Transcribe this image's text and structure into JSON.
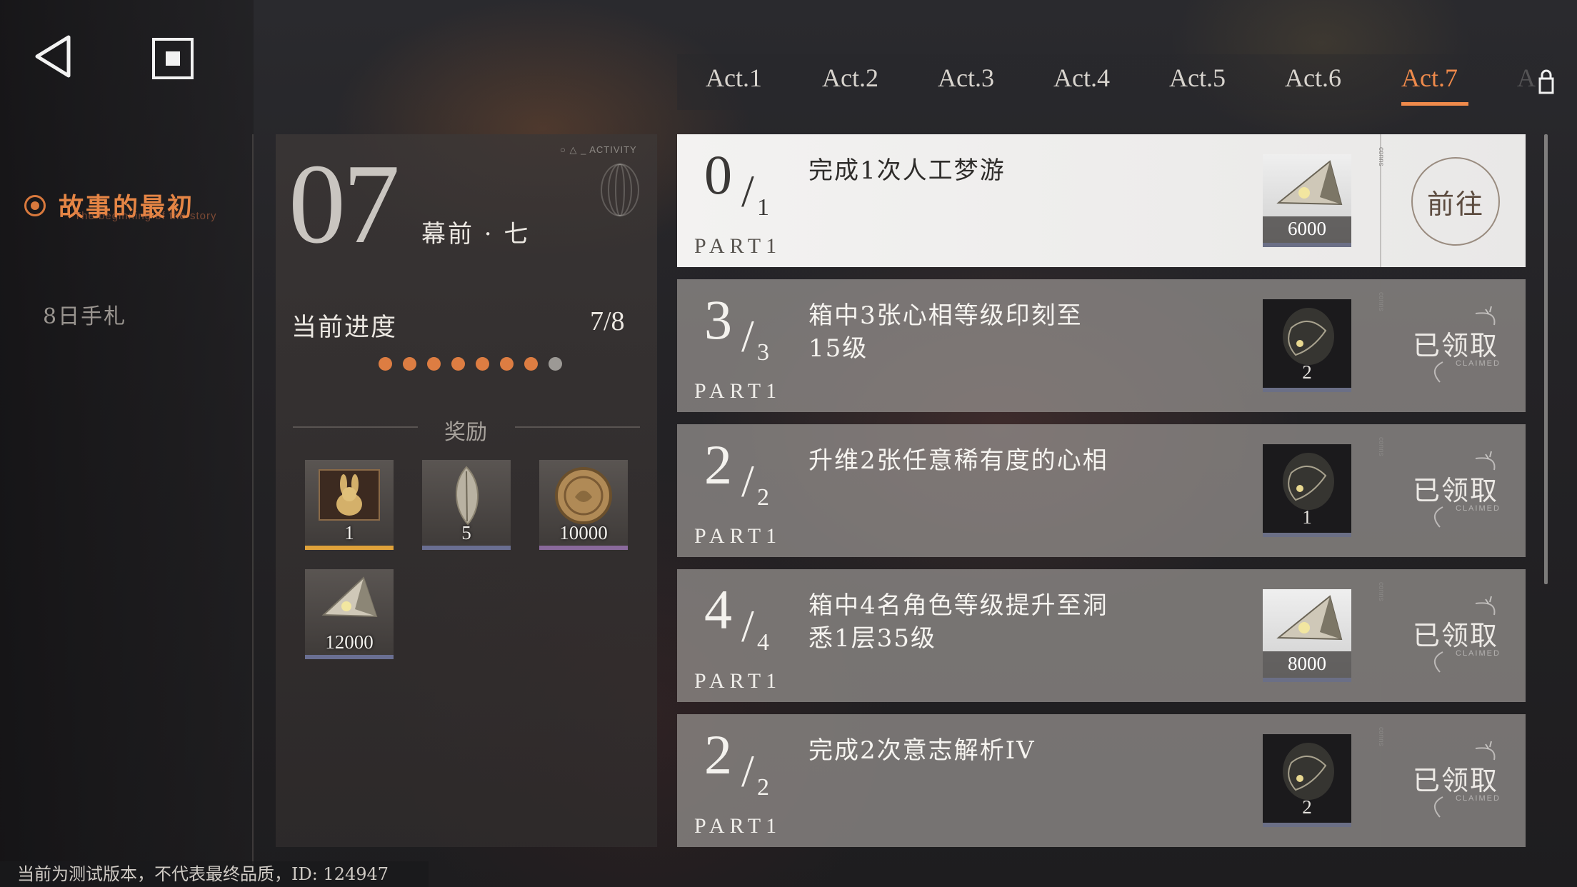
{
  "sidebar": {
    "active_item": "故事的最初",
    "active_item_sub": "The beginning of the story",
    "items": [
      {
        "label": "8日手札"
      }
    ]
  },
  "tabs": [
    {
      "label": "Act.1"
    },
    {
      "label": "Act.2"
    },
    {
      "label": "Act.3"
    },
    {
      "label": "Act.4"
    },
    {
      "label": "Act.5"
    },
    {
      "label": "Act.6"
    },
    {
      "label": "Act.7",
      "active": true
    },
    {
      "label": "A"
    }
  ],
  "act": {
    "number": "07",
    "subtitle": "幕前 · 七",
    "activity_tag": "ACTIVITY",
    "progress_label": "当前进度",
    "progress_value": "7/8",
    "progress_filled": 7,
    "progress_total": 8,
    "rewards_title": "奖励",
    "rewards": [
      {
        "icon": "rabbit-box-icon",
        "qty": "1",
        "bar_color": "#e0a23a"
      },
      {
        "icon": "feather-crystal-icon",
        "qty": "5",
        "bar_color": "#6a6f92"
      },
      {
        "icon": "coin-icon",
        "qty": "10000",
        "bar_color": "#8a6a9c"
      },
      {
        "icon": "crystal-shard-icon",
        "qty": "12000",
        "bar_color": "#6a6f92"
      }
    ]
  },
  "quests": [
    {
      "current": "0",
      "total": "1",
      "part": "PART1",
      "desc": "完成1次人工梦游",
      "reward_icon": "crystal-shard-icon",
      "reward_qty": "6000",
      "status": "前往"
    },
    {
      "current": "3",
      "total": "3",
      "part": "PART1",
      "desc": "箱中3张心相等级印刻至15级",
      "reward_icon": "spirit-icon",
      "reward_qty": "2",
      "status": "已领取"
    },
    {
      "current": "2",
      "total": "2",
      "part": "PART1",
      "desc": "升维2张任意稀有度的心相",
      "reward_icon": "spirit-icon",
      "reward_qty": "1",
      "status": "已领取"
    },
    {
      "current": "4",
      "total": "4",
      "part": "PART1",
      "desc": "箱中4名角色等级提升至洞悉1层35级",
      "reward_icon": "crystal-shard-icon",
      "reward_qty": "8000",
      "status": "已领取"
    },
    {
      "current": "2",
      "total": "2",
      "part": "PART1",
      "desc": "完成2次意志解析IV",
      "reward_icon": "spirit-icon",
      "reward_qty": "2",
      "status": "已领取"
    }
  ],
  "claimed_sub": "CLAIMED",
  "sep_tag": "conns",
  "footer_note": "当前为测试版本，不代表最终品质，ID: 124947",
  "colors": {
    "accent": "#ef8a4b",
    "progress_dot": "#dd7d42"
  }
}
